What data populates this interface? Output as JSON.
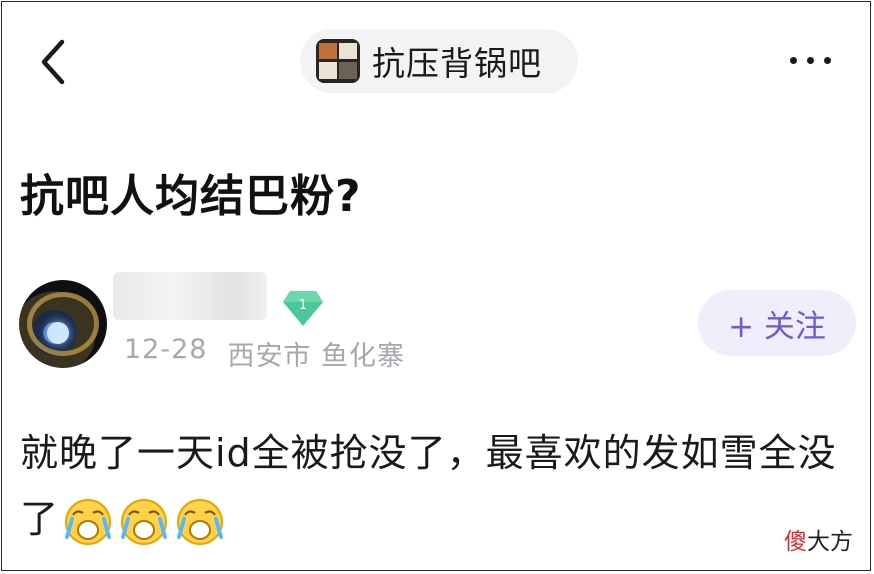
{
  "header": {
    "forum_name": "抗压背锅吧"
  },
  "post": {
    "title": "抗吧人均结巴粉?",
    "author": {
      "level": "1",
      "date": "12-28",
      "location": "西安市",
      "community": "鱼化寨"
    },
    "follow_label": "+ 关注",
    "body_text": "就晚了一天id全被抢没了，最喜欢的发如雪全没了"
  },
  "watermark": {
    "red_part": "傻",
    "black_part": "大方"
  },
  "colors": {
    "accent": "#6c5bd4",
    "follow_bg": "#f1eefb",
    "meta_text": "#a7a7ad",
    "badge_green": "#4cc79a"
  },
  "icons": [
    "back-arrow-icon",
    "more-icon",
    "level-diamond-icon",
    "crying-emoji-icon"
  ]
}
